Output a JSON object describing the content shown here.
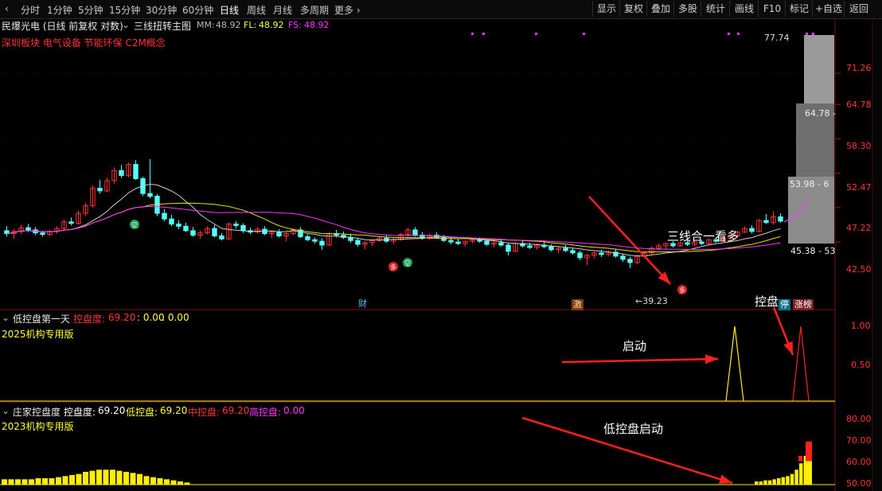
{
  "toolbar": {
    "periods": [
      "分时",
      "1分钟",
      "5分钟",
      "15分钟",
      "30分钟",
      "60分钟",
      "日线",
      "周线",
      "月线",
      "多周期",
      "更多"
    ],
    "active_period": "日线",
    "right_buttons": [
      "显示",
      "复权",
      "叠加",
      "多股",
      "统计",
      "画线",
      "F10",
      "标记",
      "+自选",
      "返回"
    ]
  },
  "main_pane": {
    "stock_title": "民爆光电 (日线 前复权 对数)",
    "indicator_name": "三线扭转主图",
    "mm_label": "MM:",
    "mm_value": "48.92",
    "fl_label": "FL:",
    "fl_value": "48.92",
    "fs_label": "FS:",
    "fs_value": "48.92",
    "concepts": "深圳板块 电气设备 节能环保 C2M概念",
    "annotation": "三线合一看多",
    "annotation2": "控盘",
    "badge_cai": "财",
    "badge_ji": "激",
    "badge_ting": "停",
    "badge_zhangbang": "涨榜",
    "low_label": "←39.23",
    "high_label": "77.74",
    "signal_duo": "多",
    "signal_kong": "空",
    "price_axis": [
      "71.26",
      "64.78",
      "58.30",
      "52.47",
      "47.22",
      "42.50"
    ],
    "chip_labels": [
      "64.78 -",
      "53.98 - 6",
      "45.38 - 53"
    ]
  },
  "pane2": {
    "name": "低控盘第一天",
    "label": "控盘度:",
    "v1": "69.20",
    "v2": ": 0.00",
    "v3": ": 0.00",
    "version": "2025机构专用版",
    "annotation": "启动",
    "axis": [
      "1.00",
      "0.50"
    ]
  },
  "pane3": {
    "name": "庄家控盘度",
    "kp_label": "控盘度:",
    "kp_value": "69.20",
    "low_label": "低控盘:",
    "low_value": "69.20",
    "mid_label": "中控盘:",
    "mid_value": "69.20",
    "high_label": "高控盘:",
    "high_value": "0.00",
    "version": "2023机构专用版",
    "annotation": "低控盘启动",
    "axis": [
      "80.00",
      "70.00",
      "60.00",
      "50.00"
    ]
  },
  "colors": {
    "up": "#ff3333",
    "down": "#54ffff",
    "ma_yellow": "#e6e600",
    "ma_purple": "#ff33ff",
    "ma_white": "#cccccc",
    "bar_yellow": "#ffee00"
  },
  "chart_data": {
    "type": "candlestick",
    "y_axis": "log",
    "ylim": [
      38,
      78
    ],
    "high_marker": 77.74,
    "low_marker": 39.23,
    "candles": [
      [
        44.0,
        44.6,
        43.2,
        43.6
      ],
      [
        43.6,
        44.2,
        42.9,
        43.9
      ],
      [
        43.9,
        44.8,
        43.5,
        44.4
      ],
      [
        44.4,
        44.9,
        43.8,
        44.1
      ],
      [
        44.1,
        44.5,
        43.4,
        43.7
      ],
      [
        43.7,
        44.0,
        43.2,
        43.5
      ],
      [
        43.5,
        44.1,
        43.3,
        43.9
      ],
      [
        43.9,
        44.6,
        43.6,
        44.3
      ],
      [
        44.3,
        45.5,
        44.0,
        45.2
      ],
      [
        45.2,
        45.8,
        44.7,
        45.0
      ],
      [
        45.0,
        46.8,
        44.8,
        46.4
      ],
      [
        46.4,
        47.9,
        46.0,
        47.5
      ],
      [
        47.5,
        50.5,
        47.2,
        50.1
      ],
      [
        50.1,
        51.4,
        49.3,
        49.7
      ],
      [
        49.7,
        51.8,
        49.5,
        51.3
      ],
      [
        51.3,
        53.4,
        50.8,
        52.9
      ],
      [
        52.9,
        53.8,
        51.7,
        52.1
      ],
      [
        52.1,
        54.2,
        51.8,
        53.9
      ],
      [
        53.9,
        54.6,
        51.4,
        51.6
      ],
      [
        51.6,
        51.9,
        48.9,
        49.3
      ],
      [
        49.3,
        54.8,
        48.6,
        48.9
      ],
      [
        48.9,
        49.2,
        46.0,
        46.4
      ],
      [
        46.4,
        47.0,
        45.3,
        45.6
      ],
      [
        45.6,
        46.2,
        44.6,
        44.9
      ],
      [
        44.9,
        45.4,
        44.2,
        44.6
      ],
      [
        44.6,
        45.1,
        43.8,
        44.0
      ],
      [
        44.0,
        44.5,
        43.2,
        43.4
      ],
      [
        43.4,
        44.0,
        42.9,
        43.7
      ],
      [
        43.7,
        44.6,
        43.5,
        44.3
      ],
      [
        44.3,
        44.8,
        43.1,
        43.3
      ],
      [
        43.3,
        43.7,
        42.7,
        42.9
      ],
      [
        42.9,
        45.1,
        42.8,
        44.9
      ],
      [
        44.9,
        45.3,
        44.3,
        44.7
      ],
      [
        44.7,
        45.0,
        43.7,
        44.0
      ],
      [
        44.0,
        44.4,
        43.5,
        43.8
      ],
      [
        43.8,
        44.5,
        43.6,
        44.2
      ],
      [
        44.2,
        44.6,
        43.4,
        43.6
      ],
      [
        43.6,
        44.0,
        43.0,
        43.8
      ],
      [
        43.8,
        44.2,
        43.1,
        43.3
      ],
      [
        43.3,
        43.8,
        42.6,
        43.6
      ],
      [
        43.6,
        44.3,
        43.4,
        44.1
      ],
      [
        44.1,
        44.5,
        43.0,
        43.2
      ],
      [
        43.2,
        43.5,
        42.6,
        42.8
      ],
      [
        42.8,
        43.1,
        42.3,
        42.6
      ],
      [
        42.6,
        43.0,
        41.5,
        42.1
      ],
      [
        42.1,
        43.8,
        42.0,
        43.6
      ],
      [
        43.6,
        44.1,
        43.1,
        43.4
      ],
      [
        43.4,
        43.9,
        42.9,
        43.1
      ],
      [
        43.1,
        43.6,
        42.4,
        42.7
      ],
      [
        42.7,
        43.0,
        41.9,
        42.2
      ],
      [
        42.2,
        42.6,
        41.6,
        42.4
      ],
      [
        42.4,
        42.9,
        42.0,
        42.7
      ],
      [
        42.7,
        43.2,
        42.5,
        43.0
      ],
      [
        43.0,
        43.4,
        42.4,
        42.6
      ],
      [
        42.6,
        43.0,
        42.2,
        42.8
      ],
      [
        42.8,
        43.7,
        42.7,
        43.5
      ],
      [
        43.5,
        44.4,
        43.2,
        44.1
      ],
      [
        44.1,
        44.5,
        43.2,
        43.4
      ],
      [
        43.4,
        43.8,
        42.8,
        43.0
      ],
      [
        43.0,
        43.6,
        42.8,
        43.4
      ],
      [
        43.4,
        43.8,
        42.9,
        43.1
      ],
      [
        43.1,
        43.4,
        42.5,
        42.7
      ],
      [
        42.7,
        43.1,
        42.2,
        42.5
      ],
      [
        42.5,
        42.9,
        42.1,
        42.3
      ],
      [
        42.3,
        42.7,
        41.9,
        42.6
      ],
      [
        42.6,
        43.0,
        42.3,
        42.8
      ],
      [
        42.8,
        43.1,
        42.4,
        42.6
      ],
      [
        42.6,
        42.9,
        42.0,
        42.2
      ],
      [
        42.2,
        42.6,
        41.8,
        42.4
      ],
      [
        42.4,
        42.8,
        41.9,
        42.1
      ],
      [
        42.1,
        42.4,
        40.8,
        41.3
      ],
      [
        41.3,
        42.5,
        41.2,
        42.3
      ],
      [
        42.3,
        42.7,
        41.8,
        42.0
      ],
      [
        42.0,
        42.4,
        41.6,
        41.8
      ],
      [
        41.8,
        42.3,
        41.5,
        42.1
      ],
      [
        42.1,
        42.6,
        41.7,
        41.9
      ],
      [
        41.9,
        42.2,
        41.3,
        41.5
      ],
      [
        41.5,
        41.9,
        41.1,
        41.7
      ],
      [
        41.7,
        42.1,
        41.2,
        41.4
      ],
      [
        41.4,
        41.7,
        40.9,
        41.1
      ],
      [
        41.1,
        41.4,
        40.2,
        40.5
      ],
      [
        40.5,
        41.0,
        39.6,
        40.8
      ],
      [
        40.8,
        41.3,
        40.4,
        41.1
      ],
      [
        41.1,
        41.5,
        40.6,
        40.9
      ],
      [
        40.9,
        41.4,
        40.7,
        41.2
      ],
      [
        41.2,
        41.6,
        40.5,
        40.7
      ],
      [
        40.7,
        41.0,
        40.0,
        40.3
      ],
      [
        40.3,
        40.6,
        39.23,
        39.9
      ],
      [
        39.9,
        40.9,
        39.7,
        40.7
      ],
      [
        40.7,
        41.3,
        40.5,
        41.1
      ],
      [
        41.1,
        41.9,
        40.9,
        41.7
      ],
      [
        41.7,
        42.3,
        41.4,
        42.0
      ],
      [
        42.0,
        42.4,
        41.6,
        42.3
      ],
      [
        42.3,
        42.6,
        41.8,
        42.0
      ],
      [
        42.0,
        42.5,
        41.9,
        42.4
      ],
      [
        42.4,
        42.7,
        42.0,
        42.2
      ],
      [
        42.2,
        42.6,
        42.0,
        42.5
      ],
      [
        42.5,
        42.8,
        42.1,
        42.3
      ],
      [
        42.3,
        42.9,
        42.2,
        42.8
      ],
      [
        42.8,
        43.1,
        42.4,
        42.6
      ],
      [
        42.6,
        43.2,
        42.5,
        43.0
      ],
      [
        43.0,
        43.5,
        42.8,
        43.3
      ],
      [
        43.3,
        44.0,
        43.1,
        43.8
      ],
      [
        43.8,
        44.6,
        43.7,
        44.3
      ],
      [
        44.3,
        44.7,
        43.6,
        43.9
      ],
      [
        43.9,
        45.6,
        43.8,
        45.4
      ],
      [
        45.4,
        46.3,
        44.9,
        45.1
      ],
      [
        45.1,
        46.7,
        44.8,
        45.9
      ],
      [
        45.9,
        46.4,
        45.1,
        45.3
      ]
    ],
    "pane2_signal": [
      0,
      0,
      0,
      0,
      0,
      0,
      0,
      0,
      0,
      0,
      0,
      0,
      0,
      0,
      0,
      0,
      0,
      0,
      0,
      0,
      0,
      0,
      0,
      0,
      0,
      0,
      0,
      0,
      0,
      0,
      0,
      0,
      0,
      0,
      0,
      0,
      0,
      0,
      0,
      0,
      0,
      0,
      0,
      0,
      0,
      0,
      0,
      0,
      0,
      0,
      0,
      0,
      0,
      0,
      0,
      0,
      0,
      0,
      0,
      0,
      0,
      0,
      0,
      0,
      0,
      0,
      0,
      0,
      0,
      0,
      0,
      0,
      0,
      0,
      0,
      0,
      0,
      0,
      0,
      0,
      0,
      0,
      0,
      0,
      0,
      0,
      0,
      0,
      0,
      0,
      0,
      0,
      0,
      0,
      0,
      0,
      0,
      0,
      0,
      0,
      0,
      0,
      0,
      0,
      0,
      0,
      0,
      0,
      0,
      0,
      0,
      0,
      0,
      0,
      0,
      0,
      0,
      0,
      0,
      0,
      0,
      0,
      0,
      0,
      0,
      0,
      0,
      0,
      0,
      0,
      0,
      0,
      0,
      0,
      0,
      0,
      0,
      0,
      0,
      0,
      0,
      0,
      0,
      0,
      0,
      0
    ],
    "pane3_bars": [
      51.5,
      51.5,
      51.5,
      51.5,
      51.5,
      52,
      52,
      52,
      52.5,
      53,
      53.5,
      54,
      55,
      55.5,
      56,
      56,
      56,
      55.5,
      55,
      54.5,
      54,
      53,
      52.5,
      52,
      51.5,
      51,
      50.5,
      50,
      50,
      49,
      49,
      49,
      49,
      49,
      49,
      49,
      49,
      49,
      49,
      49,
      49,
      49,
      49,
      49,
      49,
      49,
      49,
      49,
      49,
      49,
      49,
      49,
      49,
      49,
      49,
      49,
      49,
      49,
      49,
      49,
      49,
      49,
      49,
      49,
      49,
      49,
      49,
      49,
      49,
      49,
      49,
      49,
      49,
      49,
      49,
      49,
      49,
      49,
      49,
      49,
      49,
      49,
      49,
      49,
      49,
      49,
      49,
      49,
      49,
      49,
      49,
      49,
      49,
      49,
      49,
      49,
      49,
      49,
      49,
      49,
      49,
      49,
      49,
      49,
      49,
      49,
      49,
      49,
      49,
      49,
      49,
      49,
      49,
      49,
      49,
      49,
      49,
      49,
      50.5,
      50.5,
      51,
      51,
      51.5,
      52,
      52.5,
      53,
      54,
      56,
      59,
      62.5,
      69.2
    ]
  }
}
